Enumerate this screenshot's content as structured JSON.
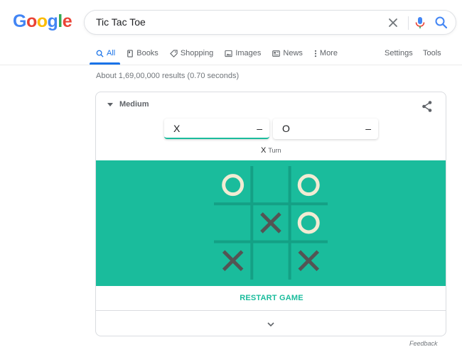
{
  "logo": {
    "letters": [
      "G",
      "o",
      "o",
      "g",
      "l",
      "e"
    ],
    "colors": [
      "#4285f4",
      "#ea4335",
      "#fbbc05",
      "#4285f4",
      "#34a853",
      "#ea4335"
    ]
  },
  "search": {
    "query": "Tic Tac Toe"
  },
  "tabs": [
    {
      "label": "All",
      "icon": "search-icon",
      "active": true
    },
    {
      "label": "Books",
      "icon": "book-icon"
    },
    {
      "label": "Shopping",
      "icon": "tag-icon"
    },
    {
      "label": "Images",
      "icon": "image-icon"
    },
    {
      "label": "News",
      "icon": "news-icon"
    },
    {
      "label": "More",
      "icon": "more-vertical-icon"
    }
  ],
  "settings_label": "Settings",
  "tools_label": "Tools",
  "results_stats": "About 1,69,00,000 results (0.70 seconds)",
  "game": {
    "difficulty": "Medium",
    "players": [
      {
        "symbol": "X",
        "score": "–",
        "active": true
      },
      {
        "symbol": "O",
        "score": "–",
        "active": false
      }
    ],
    "turn_symbol": "X",
    "turn_label": "Turn",
    "board": [
      "O",
      "",
      "O",
      "",
      "X",
      "O",
      "X",
      "",
      "X"
    ],
    "restart_label": "RESTART GAME",
    "colors": {
      "board": "#1abc9c",
      "grid": "#14a085",
      "o_mark": "#f2ebd3",
      "x_mark": "#545454"
    }
  },
  "feedback_label": "Feedback"
}
